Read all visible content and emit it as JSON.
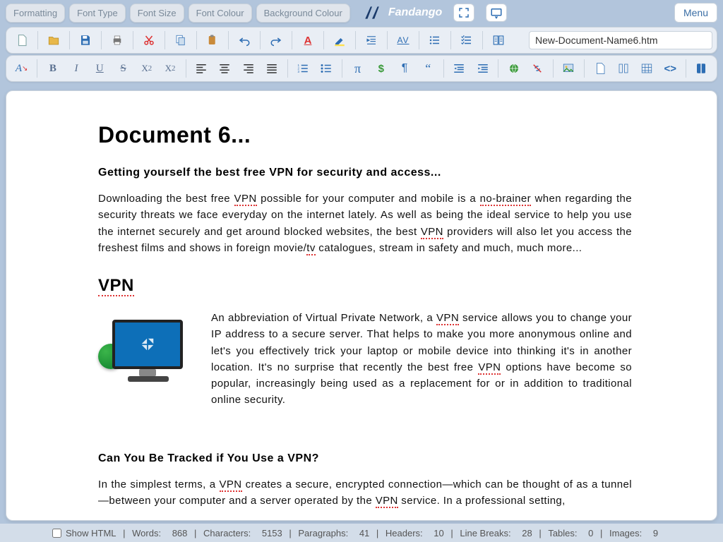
{
  "top": {
    "formatting": "Formatting",
    "font_type": "Font Type",
    "font_size": "Font Size",
    "font_colour": "Font Colour",
    "bg_colour": "Background Colour",
    "app_name": "Fandango",
    "menu": "Menu"
  },
  "filename": "New-Document-Name6.htm",
  "document": {
    "title": "Document 6...",
    "h_intro": "Getting yourself the best free VPN for security and access...",
    "p1a": "Downloading the best free ",
    "p1_vpn": "VPN",
    "p1b": " possible for your computer and mobile is a ",
    "p1_nb": "no-brainer",
    "p1c": " when regarding the security threats we face everyday on the internet lately. As well as being the ideal service to help you use the internet securely and get around blocked websites, the best ",
    "p1d": " providers will also let you access the freshest films and shows in foreign movie/",
    "p1_tv": "tv",
    "p1e": " catalogues, stream in safety and much, much more...",
    "h_vpn": "VPN",
    "p2a": "An abbreviation of Virtual Private Network, a ",
    "p2b": " service allows you to change your IP address to a secure server. That helps to make you more anonymous online and let's you effectively trick your laptop or mobile device into thinking it's in another location. It's no surprise that recently the best free ",
    "p2c": " options have become so popular, increasingly being used as a replacement for or in addition to traditional online security.",
    "h_track": "Can You Be Tracked if You Use a VPN?",
    "p3a": "In the simplest terms, a ",
    "p3b": " creates a secure, encrypted connection—which can be thought of as a tunnel—between your computer and a server operated by the ",
    "p3c": " service. In a professional setting,"
  },
  "status": {
    "show_html": "Show HTML",
    "words_l": "Words:",
    "words": "868",
    "chars_l": "Characters:",
    "chars": "5153",
    "paras_l": "Paragraphs:",
    "paras": "41",
    "headers_l": "Headers:",
    "headers": "10",
    "lb_l": "Line Breaks:",
    "lb": "28",
    "tables_l": "Tables:",
    "tables": "0",
    "images_l": "Images:",
    "images": "9"
  }
}
